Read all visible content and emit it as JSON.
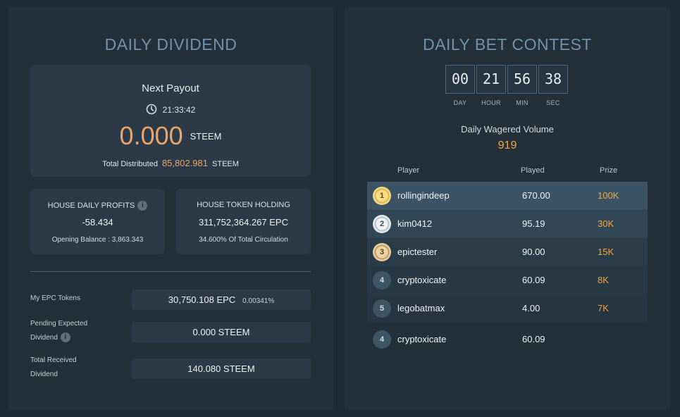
{
  "dividend": {
    "title": "DAILY DIVIDEND",
    "next_payout_label": "Next Payout",
    "next_payout_time": "21:33:42",
    "payout_amount": "0.000",
    "payout_unit": "STEEM",
    "total_distributed_label": "Total Distributed",
    "total_distributed_value": "85,802.981",
    "total_distributed_unit": "STEEM",
    "house_profits": {
      "title": "HOUSE DAILY PROFITS",
      "value": "-58.434",
      "sub": "Opening Balance : 3,863.343"
    },
    "token_holding": {
      "title": "HOUSE TOKEN HOLDING",
      "value": "311,752,364.267 EPC",
      "sub": "34.600% Of Total Circulation"
    },
    "my_tokens": {
      "label": "My EPC Tokens",
      "value": "30,750.108 EPC",
      "percent": "0.00341%"
    },
    "pending": {
      "label_line1": "Pending Expected",
      "label_line2": "Dividend",
      "value": "0.000 STEEM"
    },
    "received": {
      "label_line1": "Total Received",
      "label_line2": "Dividend",
      "value": "140.080 STEEM"
    }
  },
  "contest": {
    "title": "DAILY BET CONTEST",
    "countdown": [
      {
        "value": "00",
        "label": "DAY"
      },
      {
        "value": "21",
        "label": "HOUR"
      },
      {
        "value": "56",
        "label": "MIN"
      },
      {
        "value": "38",
        "label": "SEC"
      }
    ],
    "volume_label": "Daily Wagered Volume",
    "volume_value": "919",
    "columns": {
      "player": "Player",
      "played": "Played",
      "prize": "Prize"
    },
    "rows": [
      {
        "rank": "1",
        "player": "rollingindeep",
        "played": "670.00",
        "prize": "100K"
      },
      {
        "rank": "2",
        "player": "kim0412",
        "played": "95.19",
        "prize": "30K"
      },
      {
        "rank": "3",
        "player": "epictester",
        "played": "90.00",
        "prize": "15K"
      },
      {
        "rank": "4",
        "player": "cryptoxicate",
        "played": "60.09",
        "prize": "8K"
      },
      {
        "rank": "5",
        "player": "legobatmax",
        "played": "4.00",
        "prize": "7K"
      }
    ],
    "my_row": {
      "rank": "4",
      "player": "cryptoxicate",
      "played": "60.09"
    }
  },
  "colors": {
    "accent_orange": "#f2a63e",
    "payout_orange": "#e8a46a",
    "title_blue": "#6e93ad"
  }
}
